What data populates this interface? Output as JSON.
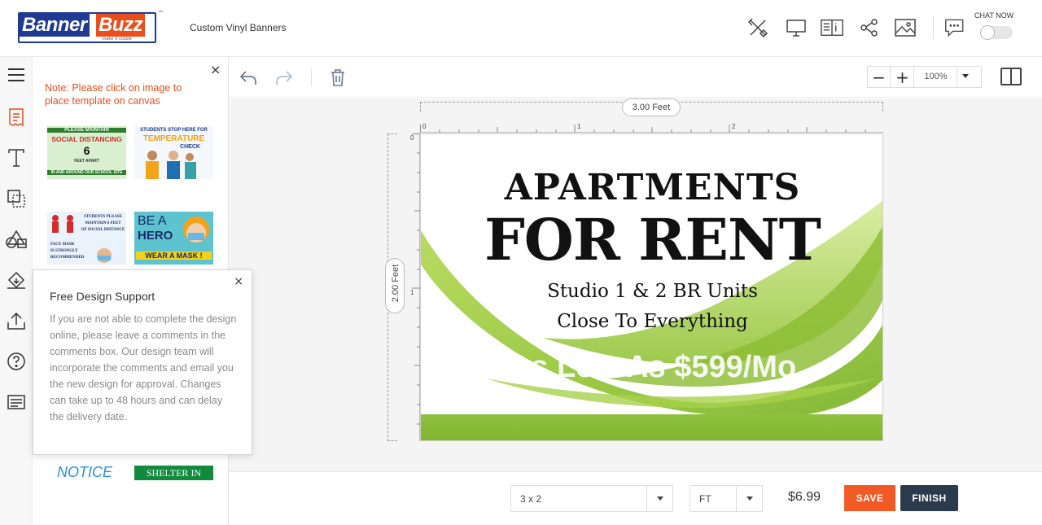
{
  "header": {
    "logo": {
      "word1": "Banner",
      "word2": "Buzz",
      "tagline": "make it visible",
      "tm": "™"
    },
    "product_name": "Custom Vinyl Banners",
    "icons": [
      "design-tools-icon",
      "monitor-icon",
      "guide-book-icon",
      "share-icon",
      "image-icon",
      "chat-bubble-icon"
    ],
    "chat_label": "CHAT NOW",
    "chat_toggle_on": false
  },
  "rail": {
    "icons": [
      "menu-icon",
      "templates-icon",
      "text-icon",
      "clipart-icon",
      "shapes-icon",
      "background-icon",
      "upload-icon",
      "help-icon",
      "comments-icon"
    ],
    "active": "templates-icon",
    "accent": "#e94e1b"
  },
  "panel": {
    "close": "×",
    "note": "Note: Please click on image to place template on canvas",
    "thumbnails": [
      {
        "lines": [
          "PLEASE MAINTAIN",
          "SOCIAL DISTANCING",
          "6",
          "FEET APART",
          "IN AND AROUND OUR SCHOOL SITE"
        ]
      },
      {
        "lines": [
          "STUDENTS STOP HERE FOR",
          "TEMPERATURE",
          "CHECK"
        ]
      },
      {
        "lines": [
          "STUDENTS PLEASE",
          "MAINTAIN 6 FEET",
          "OF SOCIAL DISTANCE",
          "FACE MASK",
          "IS STRONGLY",
          "RECOMMENDED"
        ]
      },
      {
        "lines": [
          "BE A",
          "HERO",
          "WEAR A MASK !"
        ]
      }
    ],
    "bottom_left": "NOTICE",
    "bottom_right": "SHELTER IN PLACE"
  },
  "support": {
    "close": "×",
    "title": "Free Design Support",
    "body": "If you are not able to complete the design online, please leave a comments in the comments box. Our design team will incorporate the comments and email you the new design for approval. Changes can take up to 48 hours and can delay the delivery date."
  },
  "toolbar": {
    "icons": [
      "undo-icon",
      "redo-icon",
      "delete-icon"
    ],
    "zoom_minus": "−",
    "zoom_plus": "+",
    "zoom_value": "100%"
  },
  "workspace": {
    "width_label": "3.00 Feet",
    "height_label": "2.00 Feet",
    "ruler_top_labels": [
      "0",
      "1",
      "2"
    ],
    "ruler_left_labels": [
      "0",
      "1"
    ]
  },
  "canvas": {
    "line1": "APARTMENTS",
    "line2": "FOR RENT",
    "line3": "Studio 1 & 2 BR Units",
    "line4": "Close To Everything",
    "line5": "As Low As $599/Mo",
    "accent_green": "#8fc13e"
  },
  "footer": {
    "size_value": "3 x 2",
    "unit_value": "FT",
    "price": "$6.99",
    "save_label": "SAVE",
    "finish_label": "FINISH",
    "save_color": "#f15a24",
    "finish_color": "#2c3a4d"
  }
}
